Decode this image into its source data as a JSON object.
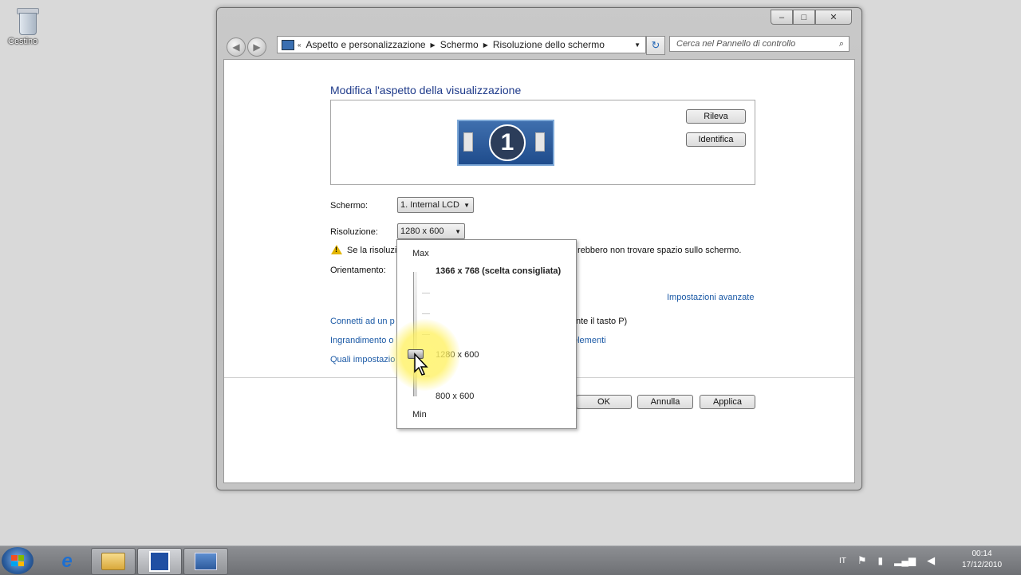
{
  "desktop": {
    "recycle_label": "Cestino"
  },
  "window": {
    "breadcrumb": [
      "Aspetto e personalizzazione",
      "Schermo",
      "Risoluzione dello schermo"
    ],
    "search_placeholder": "Cerca nel Pannello di controllo"
  },
  "page": {
    "heading": "Modifica l'aspetto della visualizzazione",
    "monitor_number": "1",
    "detect_button": "Rileva",
    "identify_button": "Identifica",
    "screen_label": "Schermo:",
    "screen_value": "1. Internal LCD",
    "resolution_label": "Risoluzione:",
    "resolution_value": "1280 x 600",
    "warning_left": "Se la risoluzi",
    "warning_right": "rebbero non trovare spazio sullo schermo.",
    "orientation_label": "Orientamento:",
    "advanced_link": "Impostazioni avanzate",
    "link1_left": "Connetti ad un p",
    "link1_right": "nte il tasto P)",
    "link2_left": "Ingrandimento o",
    "link2_right": "elementi",
    "link3_left": "Quali impostazio",
    "ok_button": "OK",
    "cancel_button": "Annulla",
    "apply_button": "Applica"
  },
  "resolution_slider": {
    "max_label": "Max",
    "min_label": "Min",
    "top_option": "1366 x 768 (scelta consigliata)",
    "selected_option": "1280 x 600",
    "bottom_option": "800 x 600"
  },
  "taskbar": {
    "language": "IT",
    "time": "00:14",
    "date": "17/12/2010"
  },
  "colors": {
    "link": "#1c5aa6",
    "heading": "#1e3a8a",
    "taskbar": "#7d7f83"
  }
}
